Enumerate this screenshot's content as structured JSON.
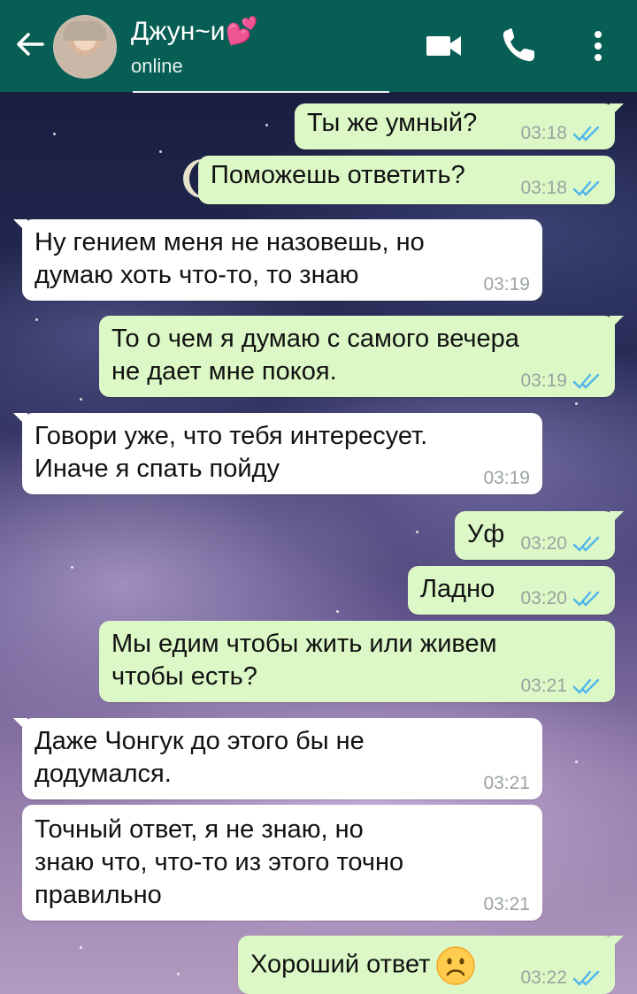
{
  "header": {
    "contact_name": "Джун~и💕",
    "status": "online",
    "colors": {
      "header_bg": "#075e54",
      "outgoing": "#dcf8c6",
      "incoming": "#ffffff",
      "tick": "#4fb6ec"
    }
  },
  "icons": {
    "back": "arrow-left-icon",
    "video": "video-camera-icon",
    "call": "phone-icon",
    "menu": "vertical-dots-icon",
    "read": "double-check-icon",
    "emoji": "frowning-face-emoji"
  },
  "messages": [
    {
      "direction": "out",
      "text": "Ты же умный?",
      "time": "03:18"
    },
    {
      "direction": "out",
      "text": "Поможешь ответить?",
      "time": "03:18"
    },
    {
      "direction": "in",
      "text_lines": [
        "Ну гением меня не назовешь, но",
        "думаю хоть что-то, то знаю"
      ],
      "time": "03:19"
    },
    {
      "direction": "out",
      "text_lines": [
        "То о чем я думаю с самого вечера",
        "не дает мне покоя."
      ],
      "time": "03:19"
    },
    {
      "direction": "in",
      "text_lines": [
        "Говори уже, что тебя интересует.",
        "Иначе я спать пойду"
      ],
      "time": "03:19"
    },
    {
      "direction": "out",
      "text": "Уф",
      "time": "03:20"
    },
    {
      "direction": "out",
      "text": "Ладно",
      "time": "03:20"
    },
    {
      "direction": "out",
      "text_lines": [
        "Мы едим чтобы жить или живем",
        "чтобы есть?"
      ],
      "time": "03:21"
    },
    {
      "direction": "in",
      "text_lines": [
        "Даже Чонгук до этого бы не",
        "додумался."
      ],
      "time": "03:21"
    },
    {
      "direction": "in",
      "text_lines": [
        "Точный ответ, я не знаю, но",
        "знаю что, что-то из этого точно",
        "правильно"
      ],
      "time": "03:21"
    },
    {
      "direction": "out",
      "text": "Хороший ответ",
      "emoji": "☹️",
      "time": "03:22"
    }
  ]
}
